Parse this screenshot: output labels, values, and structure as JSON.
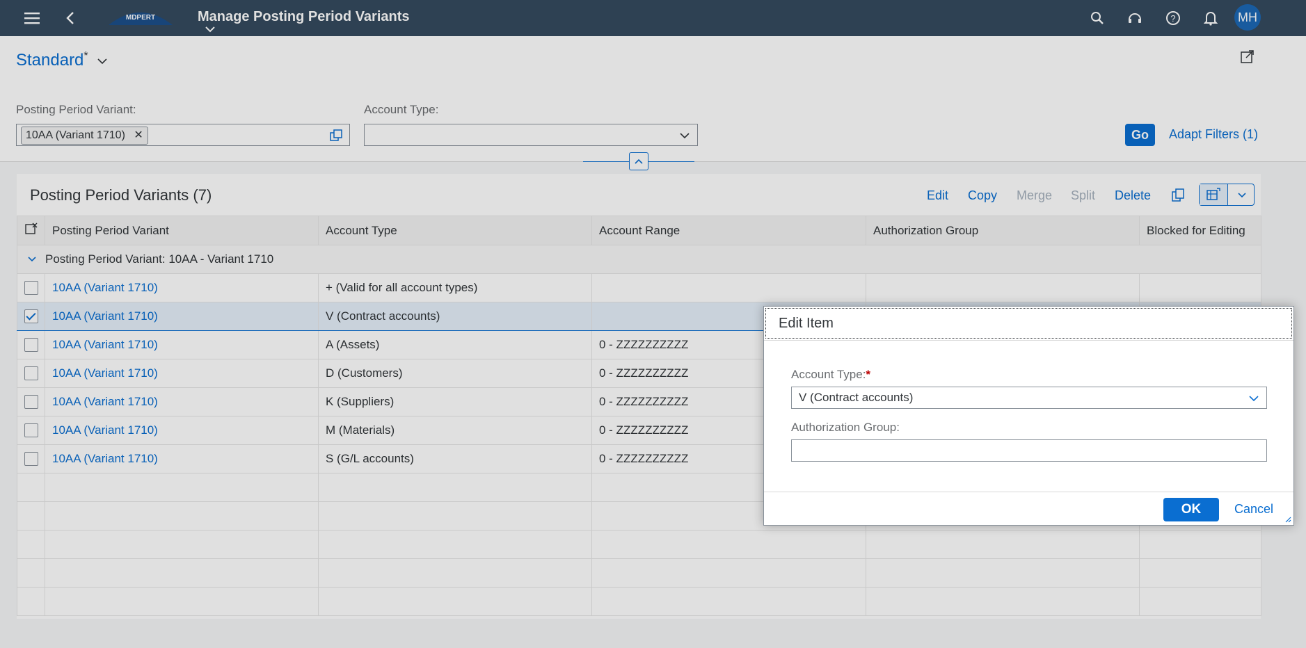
{
  "shell": {
    "logo_text": "MDPERT",
    "title": "Manage Posting Period Variants",
    "avatar_initials": "MH"
  },
  "variant": {
    "name": "Standard",
    "modified_marker": "*"
  },
  "filters": {
    "posting_period_variant_label": "Posting Period Variant:",
    "posting_period_variant_token": "10AA (Variant 1710)",
    "account_type_label": "Account Type:",
    "account_type_value": "",
    "go_label": "Go",
    "adapt_filters_label": "Adapt Filters (1)"
  },
  "table": {
    "title": "Posting Period Variants (7)",
    "toolbar": {
      "edit": "Edit",
      "copy": "Copy",
      "merge": "Merge",
      "split": "Split",
      "delete": "Delete"
    },
    "columns": [
      "Posting Period Variant",
      "Account Type",
      "Account Range",
      "Authorization Group",
      "Blocked for Editing"
    ],
    "group_label": "Posting Period Variant: 10AA - Variant 1710",
    "rows": [
      {
        "variant": "10AA (Variant 1710)",
        "account_type": "+ (Valid for all account types)",
        "range": "",
        "selected": false
      },
      {
        "variant": "10AA (Variant 1710)",
        "account_type": "V (Contract accounts)",
        "range": "",
        "selected": true
      },
      {
        "variant": "10AA (Variant 1710)",
        "account_type": "A (Assets)",
        "range": "0 - ZZZZZZZZZZ",
        "selected": false
      },
      {
        "variant": "10AA (Variant 1710)",
        "account_type": "D (Customers)",
        "range": "0 - ZZZZZZZZZZ",
        "selected": false
      },
      {
        "variant": "10AA (Variant 1710)",
        "account_type": "K (Suppliers)",
        "range": "0 - ZZZZZZZZZZ",
        "selected": false
      },
      {
        "variant": "10AA (Variant 1710)",
        "account_type": "M (Materials)",
        "range": "0 - ZZZZZZZZZZ",
        "selected": false
      },
      {
        "variant": "10AA (Variant 1710)",
        "account_type": "S (G/L accounts)",
        "range": "0 - ZZZZZZZZZZ",
        "selected": false
      }
    ]
  },
  "dialog": {
    "title": "Edit Item",
    "account_type_label": "Account Type:",
    "required_marker": "*",
    "account_type_value": "V (Contract accounts)",
    "authorization_group_label": "Authorization Group:",
    "authorization_group_value": "",
    "ok_label": "OK",
    "cancel_label": "Cancel"
  },
  "colors": {
    "shell": "#354a5f",
    "accent": "#0a6ed1",
    "required": "#bb0000"
  }
}
